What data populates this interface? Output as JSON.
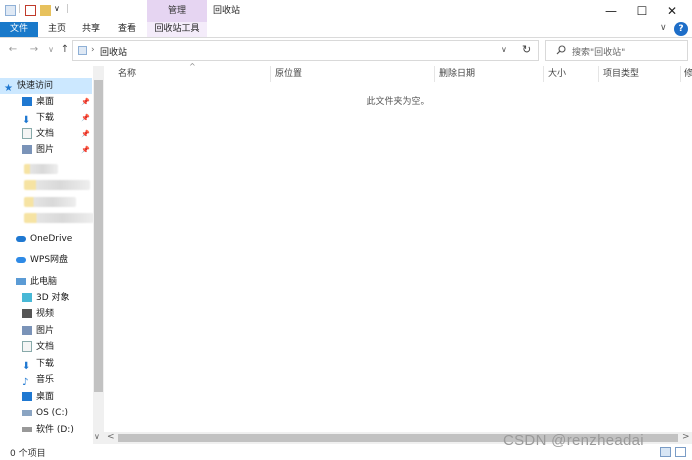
{
  "window": {
    "title": "回收站",
    "minimize_glyph": "—",
    "maximize_glyph": "☐",
    "close_glyph": "✕",
    "qat_down": "∨",
    "qat_sep": "|"
  },
  "ribbon": {
    "contextual_header": "管理",
    "tabs": [
      "文件",
      "主页",
      "共享",
      "查看",
      "回收站工具"
    ],
    "expand_glyph": "∨",
    "help_glyph": "?"
  },
  "navigation": {
    "back": "←",
    "forward": "→",
    "recent": "∨",
    "up": "↑",
    "address_sep": "›",
    "address": "回收站",
    "address_dropdown": "∨",
    "refresh": "↻",
    "search_placeholder": "搜索\"回收站\""
  },
  "sidebar": {
    "quick_access": "快速访问",
    "quick_items": [
      "桌面",
      "下载",
      "文档",
      "图片"
    ],
    "pin_glyph": "📌",
    "onedrive": "OneDrive",
    "wps": "WPS网盘",
    "this_pc": "此电脑",
    "pc_items": [
      "3D 对象",
      "视频",
      "图片",
      "文档",
      "下载",
      "音乐",
      "桌面",
      "OS (C:)",
      "软件 (D:)"
    ],
    "scroll_down": "∨"
  },
  "columns": [
    "名称",
    "原位置",
    "删除日期",
    "大小",
    "项目类型",
    "修"
  ],
  "sort_indicator": "^",
  "empty_message": "此文件夹为空。",
  "hscroll_left": "<",
  "hscroll_right": ">",
  "status": {
    "item_count": "0 个项目"
  },
  "watermark": "CSDN @renzheadai",
  "colors": {
    "file_tab": "#1979ca",
    "tool_header": "#e6d5f2",
    "selected_nav": "#cce8ff",
    "folder": "#f0c454",
    "blue_icon": "#1f78d1"
  }
}
